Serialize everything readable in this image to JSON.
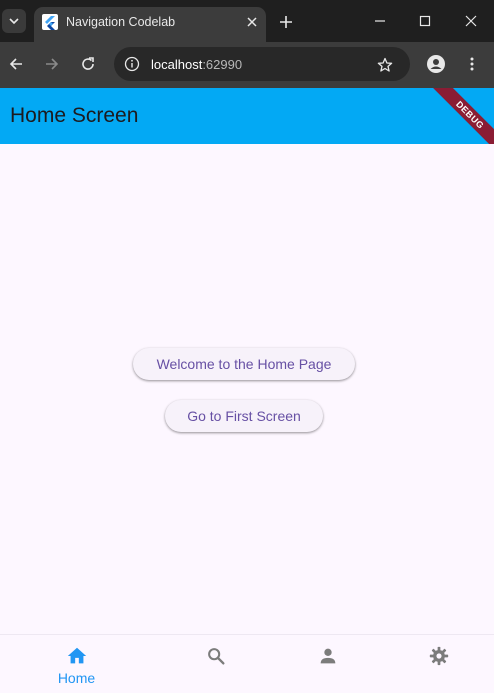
{
  "browser": {
    "tab_title": "Navigation Codelab",
    "url_host": "localhost",
    "url_port": ":62990"
  },
  "app": {
    "title": "Home Screen",
    "debug_banner": "DEBUG",
    "buttons": {
      "welcome": "Welcome to the Home Page",
      "first_screen": "Go to First Screen"
    },
    "bottom_nav": {
      "items": [
        {
          "label": "Home",
          "icon": "home-icon",
          "selected": true
        },
        {
          "label": "",
          "icon": "search-icon",
          "selected": false
        },
        {
          "label": "",
          "icon": "person-icon",
          "selected": false
        },
        {
          "label": "",
          "icon": "settings-icon",
          "selected": false
        }
      ]
    }
  },
  "colors": {
    "app_bar": "#03a9f4",
    "accent": "#2196f3",
    "button_text": "#6750a4",
    "background": "#fdf7ff"
  }
}
